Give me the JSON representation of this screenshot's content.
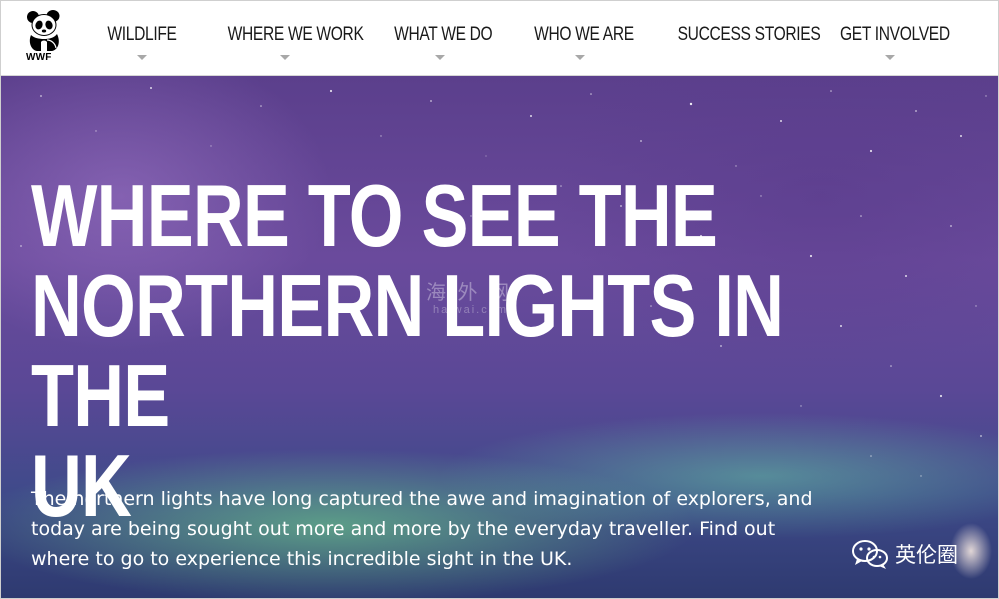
{
  "brand": {
    "logo_text": "WWF"
  },
  "nav": {
    "items": [
      {
        "label": "WILDLIFE"
      },
      {
        "label": "WHERE WE WORK"
      },
      {
        "label": "WHAT WE DO"
      },
      {
        "label": "WHO WE ARE"
      },
      {
        "label": "SUCCESS STORIES"
      },
      {
        "label": "GET INVOLVED"
      }
    ]
  },
  "hero": {
    "title_line1": "WHERE TO SEE THE",
    "title_line2": "NORTHERN LIGHTS IN THE",
    "title_line3": "UK",
    "body_line1": "The northern lights have long captured the awe and imagination of explorers, and",
    "body_line2": "today are being sought out more and more by the everyday traveller. Find out",
    "body_line3": "where to go to experience this incredible sight in the UK."
  },
  "watermark": {
    "text": "海 外 网",
    "subtext": "haiwai.com"
  },
  "badge": {
    "icon": "wechat-icon",
    "text": "英伦圈"
  },
  "colors": {
    "nav_text": "#1a1a1a",
    "caret": "#a8a8a8",
    "hero_text": "#ffffff",
    "sky_top": "#5b3f8c",
    "aurora_green": "#78e68c"
  }
}
